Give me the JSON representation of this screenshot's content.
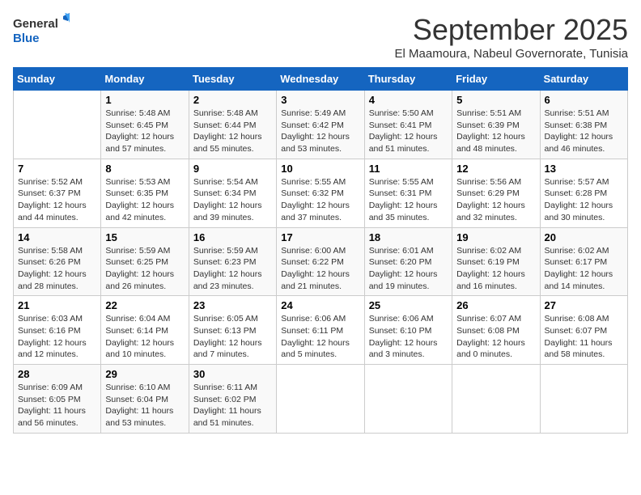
{
  "logo": {
    "line1": "General",
    "line2": "Blue"
  },
  "title": "September 2025",
  "subtitle": "El Maamoura, Nabeul Governorate, Tunisia",
  "days_header": [
    "Sunday",
    "Monday",
    "Tuesday",
    "Wednesday",
    "Thursday",
    "Friday",
    "Saturday"
  ],
  "weeks": [
    [
      {
        "day": "",
        "info": ""
      },
      {
        "day": "1",
        "info": "Sunrise: 5:48 AM\nSunset: 6:45 PM\nDaylight: 12 hours\nand 57 minutes."
      },
      {
        "day": "2",
        "info": "Sunrise: 5:48 AM\nSunset: 6:44 PM\nDaylight: 12 hours\nand 55 minutes."
      },
      {
        "day": "3",
        "info": "Sunrise: 5:49 AM\nSunset: 6:42 PM\nDaylight: 12 hours\nand 53 minutes."
      },
      {
        "day": "4",
        "info": "Sunrise: 5:50 AM\nSunset: 6:41 PM\nDaylight: 12 hours\nand 51 minutes."
      },
      {
        "day": "5",
        "info": "Sunrise: 5:51 AM\nSunset: 6:39 PM\nDaylight: 12 hours\nand 48 minutes."
      },
      {
        "day": "6",
        "info": "Sunrise: 5:51 AM\nSunset: 6:38 PM\nDaylight: 12 hours\nand 46 minutes."
      }
    ],
    [
      {
        "day": "7",
        "info": "Sunrise: 5:52 AM\nSunset: 6:37 PM\nDaylight: 12 hours\nand 44 minutes."
      },
      {
        "day": "8",
        "info": "Sunrise: 5:53 AM\nSunset: 6:35 PM\nDaylight: 12 hours\nand 42 minutes."
      },
      {
        "day": "9",
        "info": "Sunrise: 5:54 AM\nSunset: 6:34 PM\nDaylight: 12 hours\nand 39 minutes."
      },
      {
        "day": "10",
        "info": "Sunrise: 5:55 AM\nSunset: 6:32 PM\nDaylight: 12 hours\nand 37 minutes."
      },
      {
        "day": "11",
        "info": "Sunrise: 5:55 AM\nSunset: 6:31 PM\nDaylight: 12 hours\nand 35 minutes."
      },
      {
        "day": "12",
        "info": "Sunrise: 5:56 AM\nSunset: 6:29 PM\nDaylight: 12 hours\nand 32 minutes."
      },
      {
        "day": "13",
        "info": "Sunrise: 5:57 AM\nSunset: 6:28 PM\nDaylight: 12 hours\nand 30 minutes."
      }
    ],
    [
      {
        "day": "14",
        "info": "Sunrise: 5:58 AM\nSunset: 6:26 PM\nDaylight: 12 hours\nand 28 minutes."
      },
      {
        "day": "15",
        "info": "Sunrise: 5:59 AM\nSunset: 6:25 PM\nDaylight: 12 hours\nand 26 minutes."
      },
      {
        "day": "16",
        "info": "Sunrise: 5:59 AM\nSunset: 6:23 PM\nDaylight: 12 hours\nand 23 minutes."
      },
      {
        "day": "17",
        "info": "Sunrise: 6:00 AM\nSunset: 6:22 PM\nDaylight: 12 hours\nand 21 minutes."
      },
      {
        "day": "18",
        "info": "Sunrise: 6:01 AM\nSunset: 6:20 PM\nDaylight: 12 hours\nand 19 minutes."
      },
      {
        "day": "19",
        "info": "Sunrise: 6:02 AM\nSunset: 6:19 PM\nDaylight: 12 hours\nand 16 minutes."
      },
      {
        "day": "20",
        "info": "Sunrise: 6:02 AM\nSunset: 6:17 PM\nDaylight: 12 hours\nand 14 minutes."
      }
    ],
    [
      {
        "day": "21",
        "info": "Sunrise: 6:03 AM\nSunset: 6:16 PM\nDaylight: 12 hours\nand 12 minutes."
      },
      {
        "day": "22",
        "info": "Sunrise: 6:04 AM\nSunset: 6:14 PM\nDaylight: 12 hours\nand 10 minutes."
      },
      {
        "day": "23",
        "info": "Sunrise: 6:05 AM\nSunset: 6:13 PM\nDaylight: 12 hours\nand 7 minutes."
      },
      {
        "day": "24",
        "info": "Sunrise: 6:06 AM\nSunset: 6:11 PM\nDaylight: 12 hours\nand 5 minutes."
      },
      {
        "day": "25",
        "info": "Sunrise: 6:06 AM\nSunset: 6:10 PM\nDaylight: 12 hours\nand 3 minutes."
      },
      {
        "day": "26",
        "info": "Sunrise: 6:07 AM\nSunset: 6:08 PM\nDaylight: 12 hours\nand 0 minutes."
      },
      {
        "day": "27",
        "info": "Sunrise: 6:08 AM\nSunset: 6:07 PM\nDaylight: 11 hours\nand 58 minutes."
      }
    ],
    [
      {
        "day": "28",
        "info": "Sunrise: 6:09 AM\nSunset: 6:05 PM\nDaylight: 11 hours\nand 56 minutes."
      },
      {
        "day": "29",
        "info": "Sunrise: 6:10 AM\nSunset: 6:04 PM\nDaylight: 11 hours\nand 53 minutes."
      },
      {
        "day": "30",
        "info": "Sunrise: 6:11 AM\nSunset: 6:02 PM\nDaylight: 11 hours\nand 51 minutes."
      },
      {
        "day": "",
        "info": ""
      },
      {
        "day": "",
        "info": ""
      },
      {
        "day": "",
        "info": ""
      },
      {
        "day": "",
        "info": ""
      }
    ]
  ]
}
